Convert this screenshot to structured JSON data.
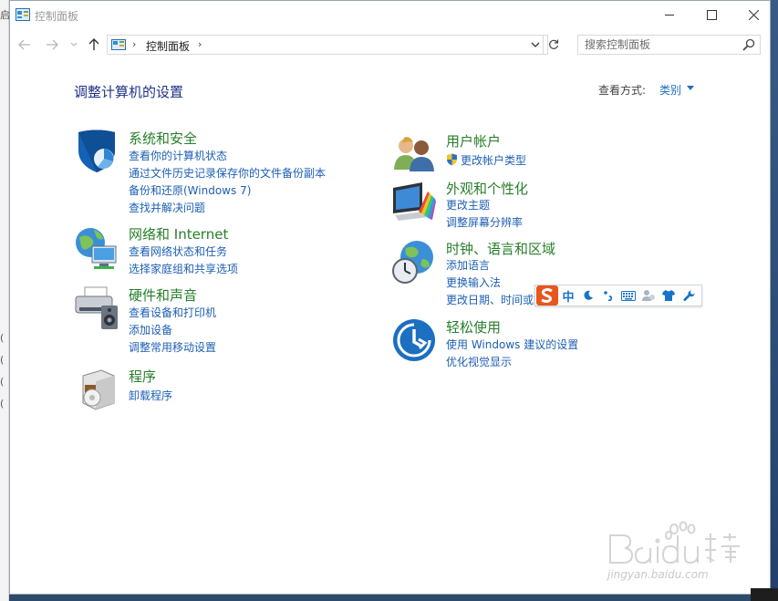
{
  "window": {
    "title": "控制面板",
    "address_crumb": "控制面板",
    "address_sep": "›",
    "search_placeholder": "搜索控制面板"
  },
  "background": {
    "left_texts": [
      "启",
      "(",
      "(",
      "(",
      "("
    ]
  },
  "main": {
    "page_title": "调整计算机的设置",
    "view_by_label": "查看方式:",
    "view_by_value": "类别"
  },
  "categories": {
    "system_security": {
      "title": "系统和安全",
      "links": [
        "查看你的计算机状态",
        "通过文件历史记录保存你的文件备份副本",
        "备份和还原(Windows 7)",
        "查找并解决问题"
      ]
    },
    "network": {
      "title": "网络和 Internet",
      "links": [
        "查看网络状态和任务",
        "选择家庭组和共享选项"
      ]
    },
    "hardware": {
      "title": "硬件和声音",
      "links": [
        "查看设备和打印机",
        "添加设备",
        "调整常用移动设置"
      ]
    },
    "programs": {
      "title": "程序",
      "links": [
        "卸载程序"
      ]
    },
    "user_accounts": {
      "title": "用户帐户",
      "links": [
        "更改帐户类型"
      ]
    },
    "appearance": {
      "title": "外观和个性化",
      "links": [
        "更改主题",
        "调整屏幕分辨率"
      ]
    },
    "clock": {
      "title": "时钟、语言和区域",
      "links": [
        "添加语言",
        "更换输入法",
        "更改日期、时间或数"
      ]
    },
    "ease": {
      "title": "轻松使用",
      "links": [
        "使用 Windows 建议的设置",
        "优化视觉显示"
      ]
    }
  },
  "ime_bar": {
    "mode_label": "中"
  },
  "watermark": {
    "url": "jingyan.baidu.com"
  },
  "colors": {
    "category_title": "#267f2a",
    "link": "#1e5fb4",
    "page_title": "#1e3287",
    "ime_accent": "#1773c8",
    "sogou_orange": "#e8561b"
  }
}
